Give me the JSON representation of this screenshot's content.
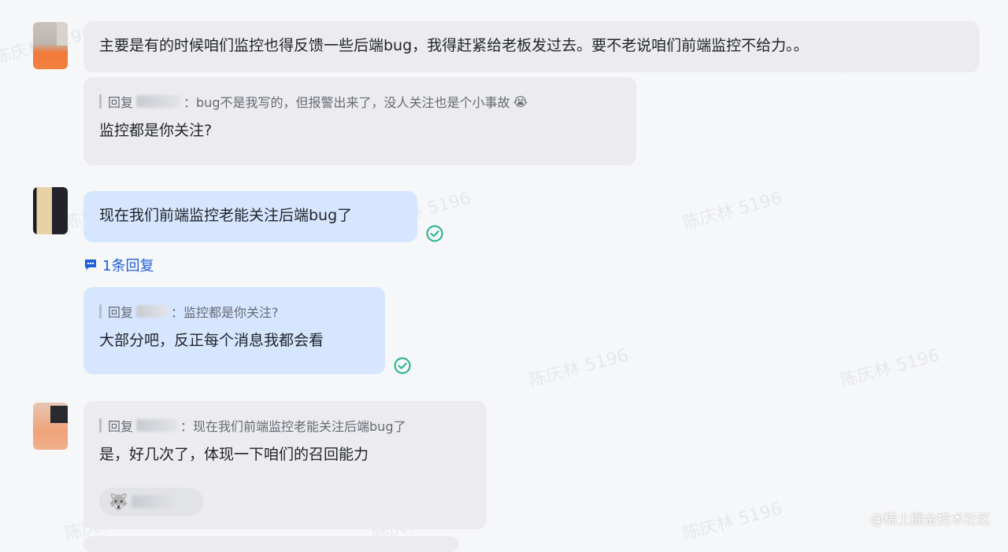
{
  "watermark_text": "陈庆林 5196",
  "messages": [
    {
      "id": "m1",
      "text": "主要是有的时候咱们监控也得反馈一些后端bug，我得赶紧给老板发过去。要不老说咱们前端监控不给力。。"
    },
    {
      "id": "m2",
      "quote_prefix": "回复",
      "quote_text": "：bug不是我写的，但报警出来了，没人关注也是个小事故",
      "quote_emoji": "😭",
      "text": "监控都是你关注?"
    },
    {
      "id": "m3",
      "text": "现在我们前端监控老能关注后端bug了"
    },
    {
      "id": "m4",
      "quote_prefix": "回复",
      "quote_text": "：监控都是你关注?",
      "text": "大部分吧，反正每个消息我都会看"
    },
    {
      "id": "m5",
      "quote_prefix": "回复",
      "quote_text": "：现在我们前端监控老能关注后端bug了",
      "text": "是，好几次了，体现一下咱们的召回能力"
    }
  ],
  "reply_count_label": "1条回复",
  "reaction_emoji": "🐺",
  "site_watermark": "@稀土掘金技术社区",
  "colors": {
    "bubble_gray": "#ececef",
    "bubble_blue": "#d6e6ff",
    "read_check": "#1fb385",
    "link_blue": "#1f5fd6"
  }
}
